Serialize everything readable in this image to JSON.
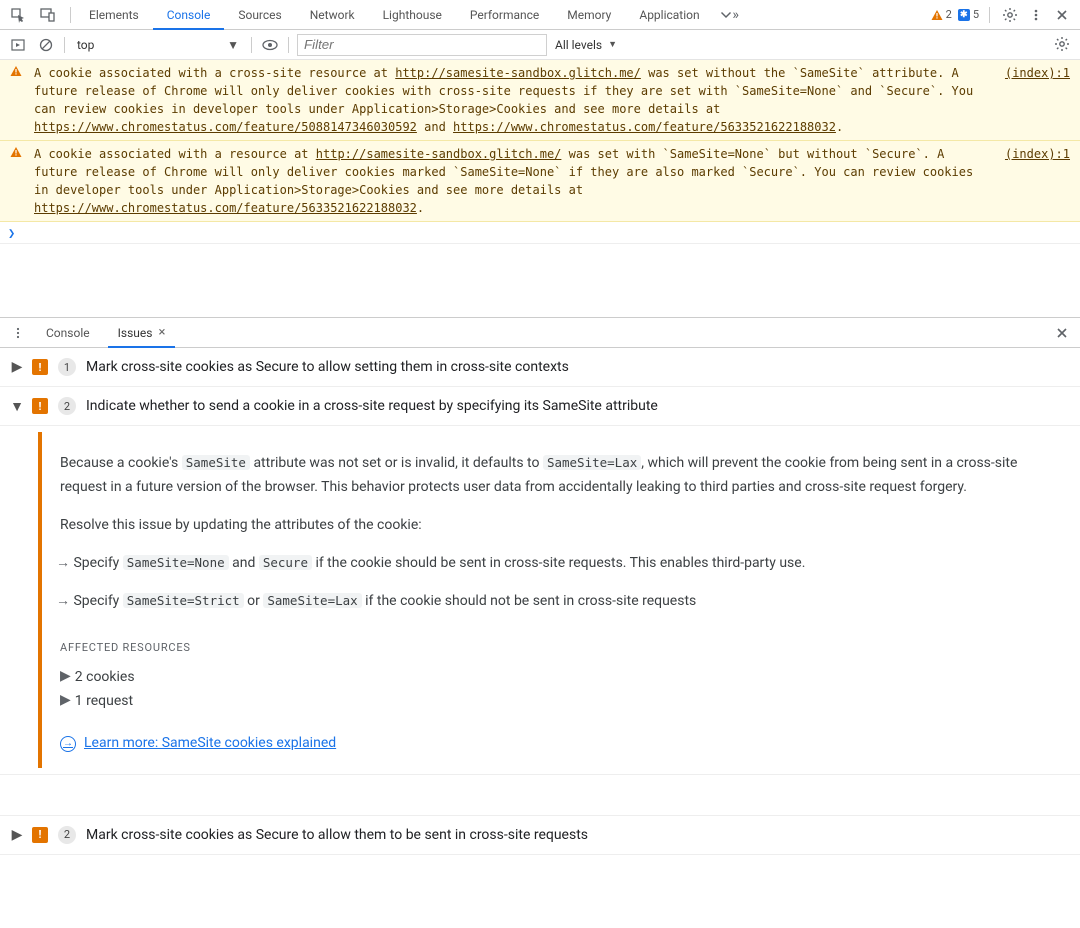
{
  "header": {
    "tabs": [
      "Elements",
      "Console",
      "Sources",
      "Network",
      "Lighthouse",
      "Performance",
      "Memory",
      "Application"
    ],
    "active_tab": "Console",
    "warning_chip_count": "2",
    "info_chip_count": "5"
  },
  "filterbar": {
    "context": "top",
    "filter_placeholder": "Filter",
    "levels_label": "All levels"
  },
  "console_warnings": [
    {
      "pre": "A cookie associated with a cross-site resource at ",
      "link1": "http://samesite-sandbox.glitch.me/",
      "mid": " was set without the `SameSite` attribute. A future release of Chrome will only deliver cookies with cross-site requests if they are set with `SameSite=None` and `Secure`. You can review cookies in developer tools under Application>Storage>Cookies and see more details at ",
      "link2": "https://www.chromestatus.com/feature/5088147346030592",
      "and": " and ",
      "link3": "https://www.chromestatus.com/feature/5633521622188032",
      "tail": ".",
      "src": "(index):1"
    },
    {
      "pre": "A cookie associated with a resource at ",
      "link1": "http://samesite-sandbox.glitch.me/",
      "mid": " was set with `SameSite=None` but without `Secure`. A future release of Chrome will only deliver cookies marked `SameSite=None` if they are also marked `Secure`. You can review cookies in developer tools under Application>Storage>Cookies and see more details at ",
      "link2": "https://www.chromestatus.com/feature/5633521622188032",
      "and": "",
      "link3": "",
      "tail": ".",
      "src": "(index):1"
    }
  ],
  "drawer": {
    "tabs": {
      "console": "Console",
      "issues": "Issues"
    },
    "active": "Issues"
  },
  "issues": [
    {
      "count": "1",
      "title": "Mark cross-site cookies as Secure to allow setting them in cross-site contexts",
      "expanded": false
    },
    {
      "count": "2",
      "title": "Indicate whether to send a cookie in a cross-site request by specifying its SameSite attribute",
      "expanded": true,
      "body": {
        "p1_a": "Because a cookie's ",
        "c_samesite": "SameSite",
        "p1_b": " attribute was not set or is invalid, it defaults to ",
        "c_lax": "SameSite=Lax",
        "p1_c": ", which will prevent the cookie from being sent in a cross-site request in a future version of the browser. This behavior protects user data from accidentally leaking to third parties and cross-site request forgery.",
        "p2": "Resolve this issue by updating the attributes of the cookie:",
        "b1_a": "Specify ",
        "c_none": "SameSite=None",
        "b1_b": " and ",
        "c_secure": "Secure",
        "b1_c": " if the cookie should be sent in cross-site requests. This enables third-party use.",
        "b2_a": "Specify ",
        "c_strict": "SameSite=Strict",
        "b2_b": " or ",
        "c_lax2": "SameSite=Lax",
        "b2_c": " if the cookie should not be sent in cross-site requests",
        "affected_h": "AFFECTED RESOURCES",
        "affected_items": [
          "2 cookies",
          "1 request"
        ],
        "learn_more": "Learn more: SameSite cookies explained"
      }
    },
    {
      "count": "2",
      "title": "Mark cross-site cookies as Secure to allow them to be sent in cross-site requests",
      "expanded": false
    }
  ]
}
